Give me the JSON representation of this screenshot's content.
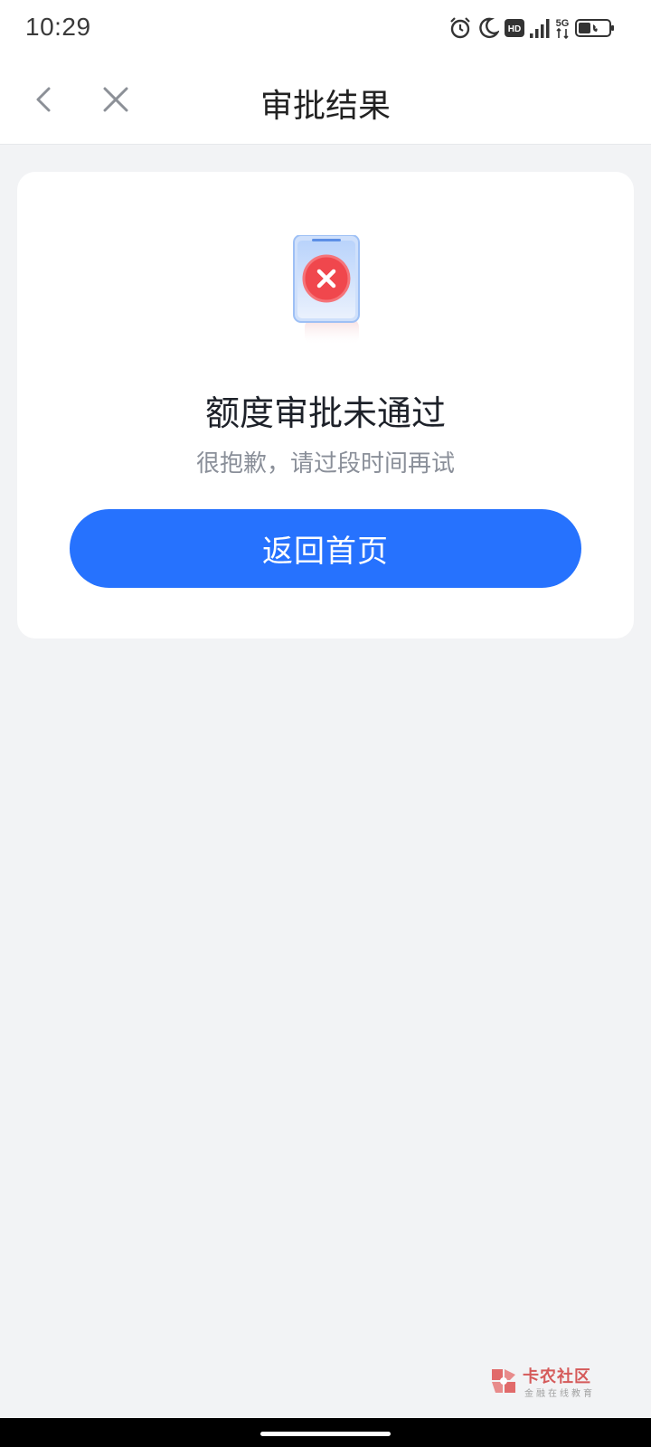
{
  "status_bar": {
    "time": "10:29",
    "hd_label": "HD",
    "network_label": "5G"
  },
  "nav": {
    "title": "审批结果",
    "back_icon": "chevron-left-icon",
    "close_icon": "close-icon"
  },
  "result": {
    "title": "额度审批未通过",
    "subtitle": "很抱歉，请过段时间再试",
    "button_label": "返回首页",
    "illustration": "phone-rejected-icon"
  },
  "watermark": {
    "name": "卡农社区",
    "tagline": "金融在线教育"
  },
  "colors": {
    "primary": "#2672fe",
    "error": "#f0474d",
    "background": "#f2f3f5",
    "card": "#ffffff"
  }
}
